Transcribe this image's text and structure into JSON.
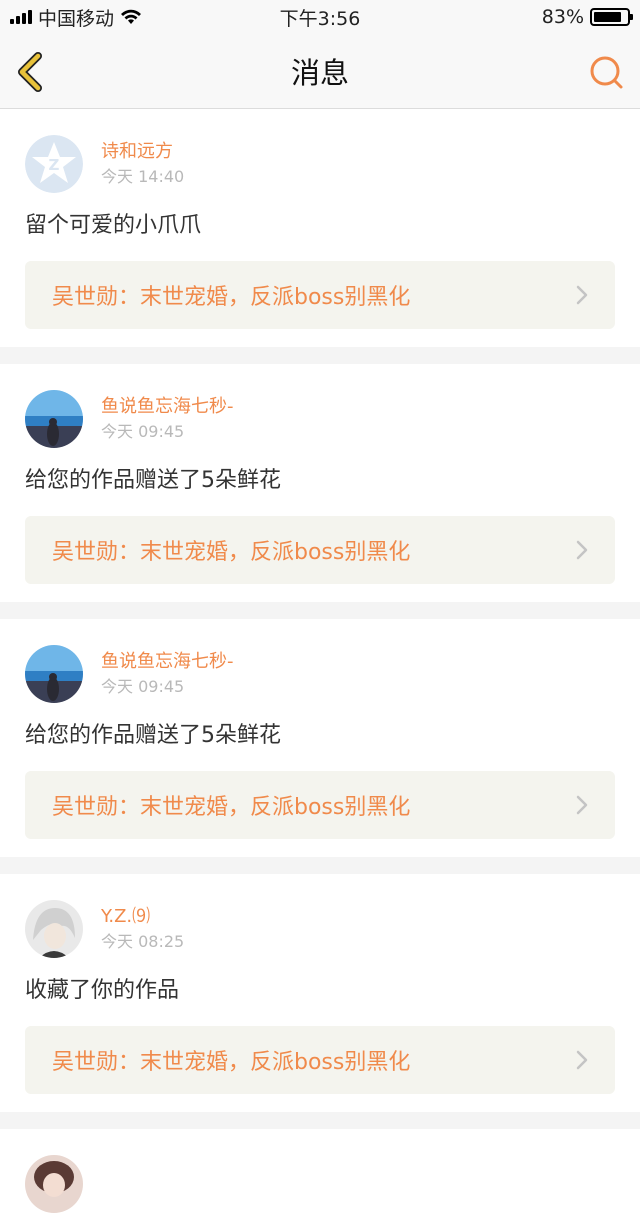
{
  "status_bar": {
    "carrier": "中国移动",
    "time": "下午3:56",
    "battery_percent": "83%",
    "battery_level": 0.83
  },
  "nav": {
    "title": "消息"
  },
  "messages": [
    {
      "username": "诗和远方",
      "time": "今天 14:40",
      "text": "留个可爱的小爪爪",
      "work_title": "吴世勋：末世宠婚，反派boss别黑化"
    },
    {
      "username": "鱼说鱼忘海七秒-",
      "time": "今天 09:45",
      "text": "给您的作品赠送了5朵鲜花",
      "work_title": "吴世勋：末世宠婚，反派boss别黑化"
    },
    {
      "username": "鱼说鱼忘海七秒-",
      "time": "今天 09:45",
      "text": "给您的作品赠送了5朵鲜花",
      "work_title": "吴世勋：末世宠婚，反派boss别黑化"
    },
    {
      "username": "Y.Z.⑼",
      "time": "今天 08:25",
      "text": "收藏了你的作品",
      "work_title": "吴世勋：末世宠婚，反派boss别黑化"
    },
    {
      "username": "",
      "time": "",
      "text": "",
      "work_title": ""
    }
  ],
  "colors": {
    "accent": "#f08a4b",
    "back_icon": "#e8c23a"
  }
}
